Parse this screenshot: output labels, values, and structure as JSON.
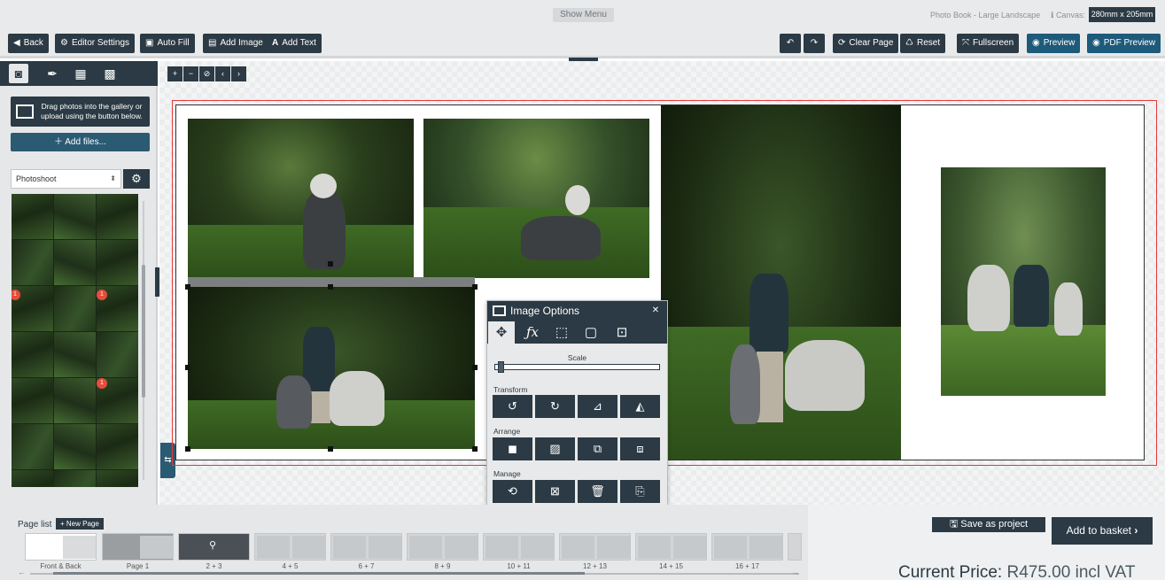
{
  "topbar": {
    "show_menu": "Show Menu",
    "product_name": "Photo Book - Large Landscape",
    "canvas_label": "Canvas:",
    "canvas_size": "280mm x 205mm"
  },
  "toolbar": {
    "back": "Back",
    "editor_settings": "Editor Settings",
    "auto_fill": "Auto Fill",
    "add_image": "Add Image",
    "add_text": "Add Text",
    "clear_page": "Clear Page",
    "reset": "Reset",
    "fullscreen": "Fullscreen",
    "preview": "Preview",
    "pdf_preview": "PDF Preview"
  },
  "sidebar": {
    "drag_info": "Drag photos into the gallery or upload using the button below.",
    "add_files": "Add files...",
    "album": "Photoshoot",
    "badges": [
      "1",
      "1",
      "1"
    ]
  },
  "image_options": {
    "title": "Image Options",
    "scale_label": "Scale",
    "scale_value": 0.02,
    "transform_label": "Transform",
    "arrange_label": "Arrange",
    "manage_label": "Manage"
  },
  "pagelist": {
    "label": "Page list",
    "new_page": "New Page",
    "pages": [
      "Front & Back",
      "Page 1",
      "2 + 3",
      "4 + 5",
      "6 + 7",
      "8 + 9",
      "10 + 11",
      "12 + 13",
      "14 + 15",
      "16 + 17"
    ]
  },
  "checkout": {
    "save_project": "Save as project",
    "add_basket": "Add to basket",
    "price_label": "Current Price:",
    "price_value": "R475.00 incl VAT"
  },
  "colors": {
    "primary": "#2b3a44",
    "accent": "#1e5a7a",
    "bleed_line": "#e23b3b"
  }
}
